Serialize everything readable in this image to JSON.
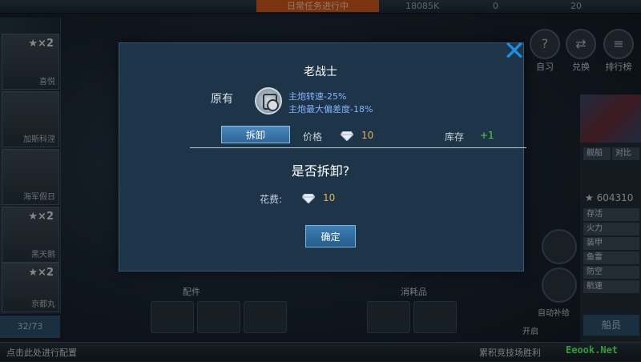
{
  "background": {
    "top_orange_label": "日常任务进行中",
    "top_stats": [
      "18085K",
      "0",
      "20"
    ],
    "left_cards": [
      {
        "count": "★×2",
        "name": "喜悦"
      },
      {
        "count": "",
        "name": "加斯科涅"
      },
      {
        "count": "",
        "name": "海军假日"
      },
      {
        "count": "★×2",
        "name": "黑天鹅"
      },
      {
        "count": "★×2",
        "name": "京都丸"
      }
    ],
    "left_footer": "32/73",
    "right_icons": [
      "自习",
      "兑换",
      "排行榜"
    ],
    "right_score": "★ 604310",
    "right_rows": [
      "舰船",
      "对比",
      "存活",
      "火力",
      "装甲",
      "鱼雷",
      "防空",
      "航速"
    ],
    "right_button": "船员",
    "section_labels": [
      "配件",
      "消耗品"
    ],
    "side_labels": [
      "自动补给",
      "开启"
    ],
    "bottom_left_text": "点击此处进行配置",
    "bottom_right_text": "累积竞技场胜利"
  },
  "modal": {
    "title": "老战士",
    "original_label": "原有",
    "effects": [
      "主炮转速-25%",
      "主炮最大偏差度-18%"
    ],
    "remove_button": "拆卸",
    "price_label": "价格",
    "price_value": "10",
    "stock_label": "库存",
    "stock_value": "+1",
    "question": "是否拆卸?",
    "cost_label": "花费:",
    "cost_value": "10",
    "confirm_button": "确定",
    "close_icon": "✕"
  },
  "watermark": "Eeook.Net",
  "colors": {
    "modal_bg": "#1e3448",
    "accent_blue": "#1e8de6",
    "effect_text": "#7fb6ff",
    "price_gold": "#e4b34a",
    "stock_green": "#57d14a"
  }
}
